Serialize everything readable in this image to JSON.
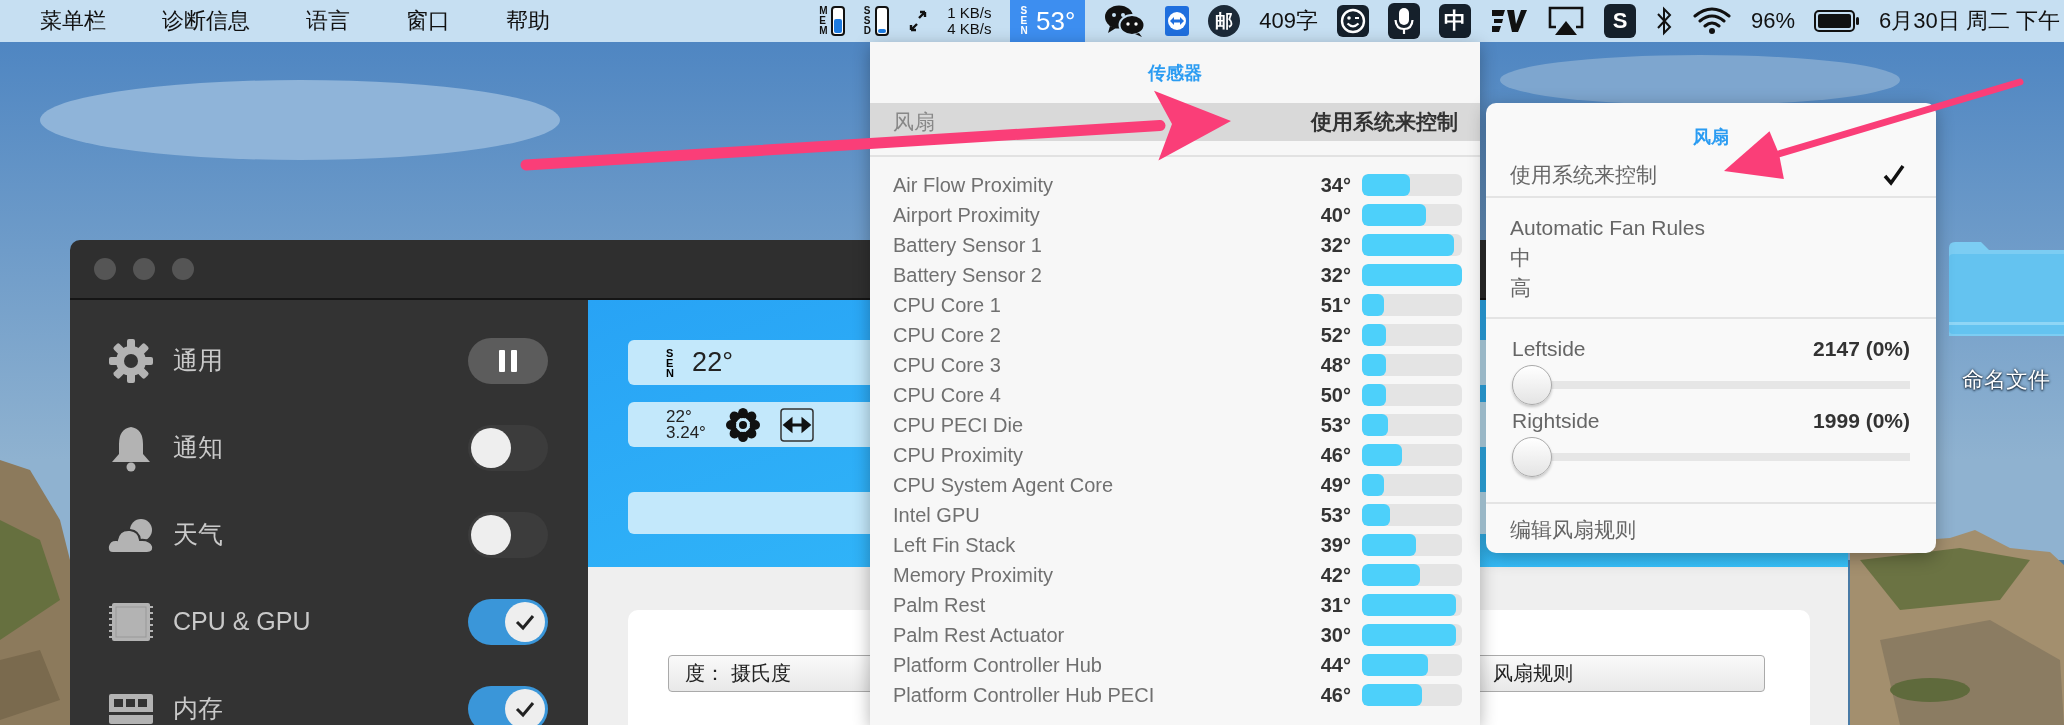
{
  "menu_bar": {
    "menus": [
      "菜单栏",
      "诊断信息",
      "语言",
      "窗口",
      "帮助"
    ],
    "status_items": [
      {
        "kind": "gauge",
        "label": "MEM",
        "level": 0.6
      },
      {
        "kind": "gauge",
        "label": "SSD",
        "level": 0.15
      },
      {
        "kind": "swap-icon"
      },
      {
        "kind": "net",
        "upload": "1 KB/s",
        "download": "4 KB/s"
      },
      {
        "kind": "sensor",
        "label": "SEN",
        "value": "53°",
        "highlighted": true
      },
      {
        "kind": "chat-icon"
      },
      {
        "kind": "remote-icon"
      },
      {
        "kind": "round-badge",
        "text": "邮"
      },
      {
        "kind": "text",
        "text": "409字"
      },
      {
        "kind": "smiley-icon"
      },
      {
        "kind": "mic-icon"
      },
      {
        "kind": "square-badge",
        "text": "中"
      },
      {
        "kind": "logo-icon"
      },
      {
        "kind": "airplay-icon"
      },
      {
        "kind": "square-badge",
        "text": "S"
      },
      {
        "kind": "bluetooth-icon"
      },
      {
        "kind": "wifi-icon"
      },
      {
        "kind": "text",
        "text": "96%"
      },
      {
        "kind": "battery-icon"
      },
      {
        "kind": "text",
        "text": "6月30日 周二 下午"
      }
    ]
  },
  "sidebar": {
    "items": [
      {
        "label": "通用",
        "kind": "pause"
      },
      {
        "label": "通知",
        "kind": "toggle",
        "on": false
      },
      {
        "label": "天气",
        "kind": "toggle",
        "on": false
      },
      {
        "label": "CPU & GPU",
        "kind": "toggle",
        "on": true
      },
      {
        "label": "内存",
        "kind": "toggle",
        "on": true
      }
    ]
  },
  "panel": {
    "widgets": [
      {
        "kind": "sensor",
        "label": "SEN",
        "value": "22°"
      },
      {
        "kind": "fan",
        "lines": [
          "22°",
          "3.24°"
        ]
      }
    ],
    "fields": [
      "度：  摄氏度",
      "风扇规则"
    ]
  },
  "sensors_popup": {
    "title": "传感器",
    "fan_row": {
      "label": "风扇",
      "value": "使用系统来控制"
    },
    "sensors": [
      {
        "name": "Air Flow Proximity",
        "value": "34°",
        "level": 0.48
      },
      {
        "name": "Airport Proximity",
        "value": "40°",
        "level": 0.64
      },
      {
        "name": "Battery Sensor 1",
        "value": "32°",
        "level": 0.92
      },
      {
        "name": "Battery Sensor 2",
        "value": "32°",
        "level": 1.0
      },
      {
        "name": "CPU Core 1",
        "value": "51°",
        "level": 0.22
      },
      {
        "name": "CPU Core 2",
        "value": "52°",
        "level": 0.24
      },
      {
        "name": "CPU Core 3",
        "value": "48°",
        "level": 0.24
      },
      {
        "name": "CPU Core 4",
        "value": "50°",
        "level": 0.24
      },
      {
        "name": "CPU PECI Die",
        "value": "53°",
        "level": 0.26
      },
      {
        "name": "CPU Proximity",
        "value": "46°",
        "level": 0.4
      },
      {
        "name": "CPU System Agent Core",
        "value": "49°",
        "level": 0.22
      },
      {
        "name": "Intel GPU",
        "value": "53°",
        "level": 0.28
      },
      {
        "name": "Left Fin Stack",
        "value": "39°",
        "level": 0.54
      },
      {
        "name": "Memory Proximity",
        "value": "42°",
        "level": 0.58
      },
      {
        "name": "Palm Rest",
        "value": "31°",
        "level": 0.94
      },
      {
        "name": "Palm Rest Actuator",
        "value": "30°",
        "level": 0.94
      },
      {
        "name": "Platform Controller Hub",
        "value": "44°",
        "level": 0.66
      },
      {
        "name": "Platform Controller Hub PECI",
        "value": "46°",
        "level": 0.6
      }
    ]
  },
  "fan_popup": {
    "title": "风扇",
    "modes": [
      {
        "label": "使用系统来控制",
        "checked": true
      }
    ],
    "rules": [
      {
        "label": "Automatic Fan Rules",
        "checked": false
      },
      {
        "label": "中",
        "checked": false
      },
      {
        "label": "高",
        "checked": false
      }
    ],
    "fans": [
      {
        "name": "Leftside",
        "reading": "2147 (0%)",
        "level": 0
      },
      {
        "name": "Rightside",
        "reading": "1999 (0%)",
        "level": 0
      }
    ],
    "footer": "编辑风扇规则"
  },
  "desktop": {
    "folder_label": "命名文件"
  }
}
